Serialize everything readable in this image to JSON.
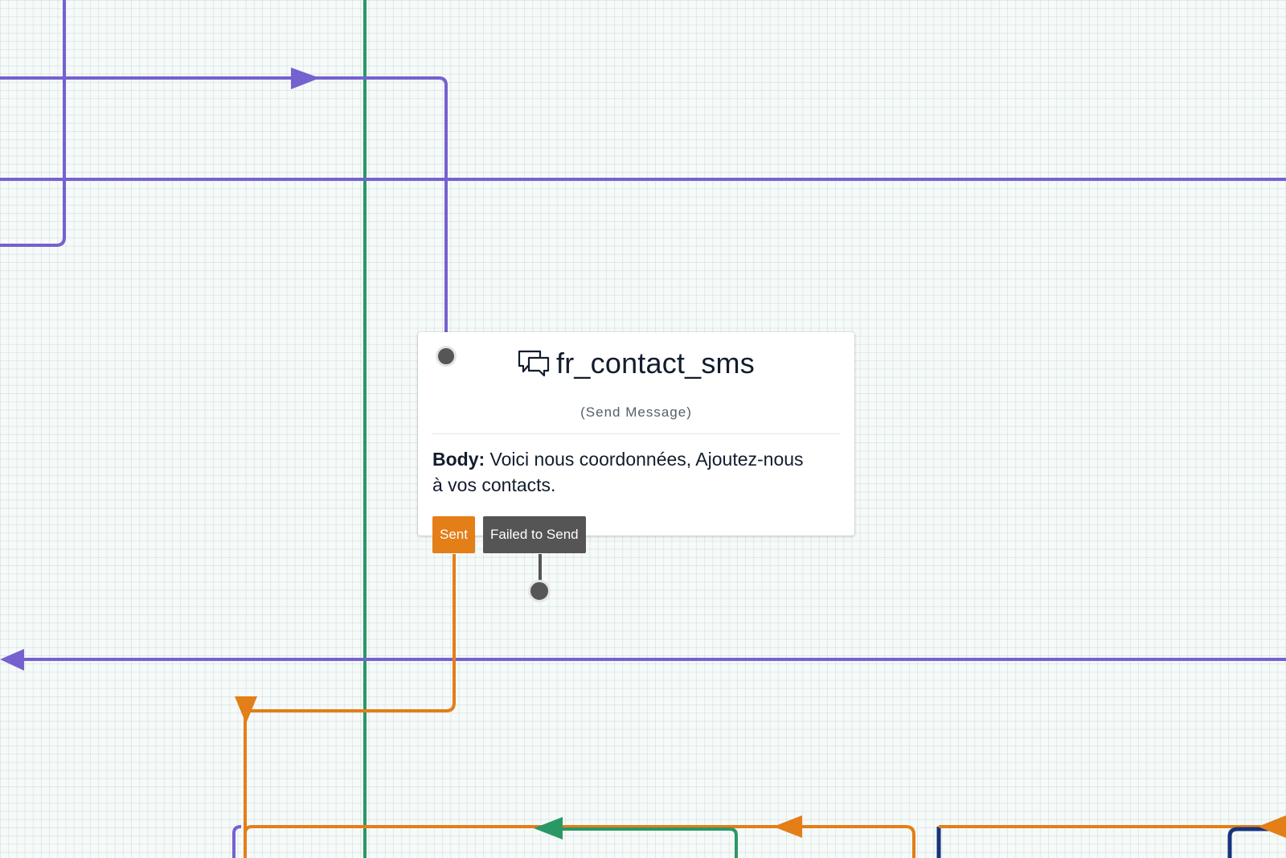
{
  "colors": {
    "purple": "#7661d0",
    "green": "#2a9865",
    "orange": "#e47e17",
    "navy": "#17347d",
    "gray": "#555555"
  },
  "widget": {
    "icon": "chat-bubbles-icon",
    "name": "fr_contact_sms",
    "type": "(Send Message)",
    "body_label": "Body:",
    "body_text": " Voici nous coordonnées, Ajoutez-nous à vos contacts.",
    "transitions": {
      "sent": "Sent",
      "failed": "Failed to Send"
    }
  }
}
